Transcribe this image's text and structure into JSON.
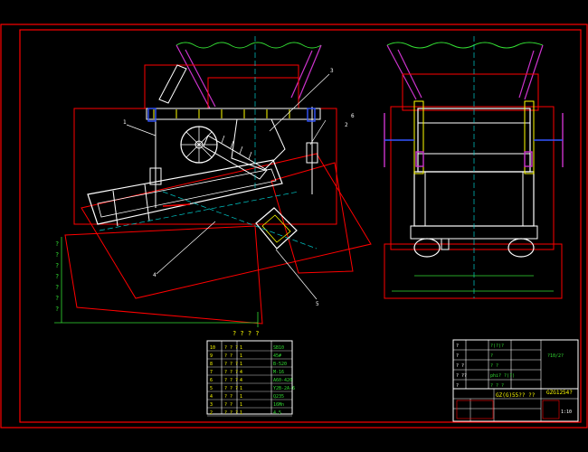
{
  "colors": {
    "background": "#000000",
    "frame": "#ff0000",
    "structure": "#ffffff",
    "hopper": "#cc33cc",
    "dimension": "#33dd33",
    "centerline": "#00cccc",
    "accent": "#ffff00",
    "blue": "#3355ff"
  },
  "leaders": [
    "1",
    "2",
    "3",
    "4",
    "5",
    "6"
  ],
  "parts_table": {
    "title": "? ? ? ?",
    "rows": [
      [
        "10",
        "? ? ?",
        "1",
        "SB10"
      ],
      [
        "9",
        "? ?",
        "1",
        "45#"
      ],
      [
        "8",
        "? ? ?",
        "1",
        "B-520"
      ],
      [
        "7",
        "? ? ?",
        "4",
        "M-16"
      ],
      [
        "6",
        "? ? ?",
        "4",
        "A60-420"
      ],
      [
        "5",
        "? ? ?",
        "1",
        "Y2B-2A-6"
      ],
      [
        "4",
        "? ?",
        "1",
        "Q235"
      ],
      [
        "3",
        "? ?",
        "1",
        "16Mn"
      ],
      [
        "2",
        "? ? ?",
        "1",
        "4.5"
      ]
    ]
  },
  "title_block": {
    "drawing_no": "GZ(G)55?? ??",
    "name": "GZG1254?",
    "spec": "?10/2?",
    "scale": "1:10",
    "rows_left": [
      "?",
      "?",
      "? ?",
      "? ??",
      "?"
    ],
    "rows_mid": [
      "?(?)?",
      "?",
      "? ?",
      "phi? ?(?)",
      "? ? ?"
    ]
  }
}
